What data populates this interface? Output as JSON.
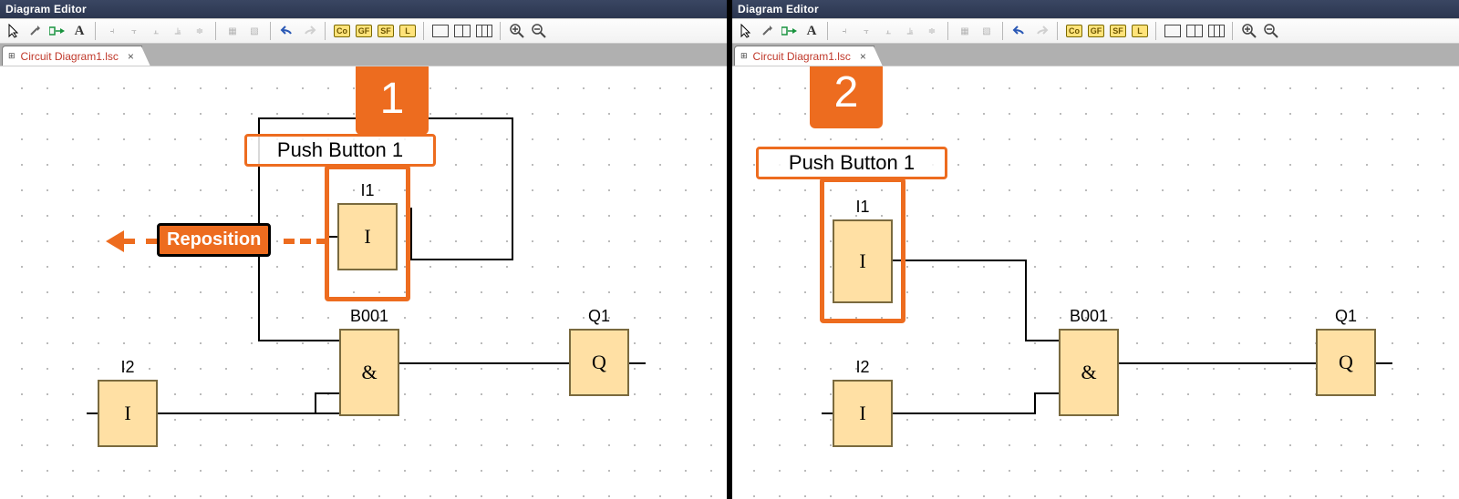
{
  "app": {
    "title": "Diagram Editor"
  },
  "tab": {
    "filename": "Circuit Diagram1.lsc",
    "close": "×"
  },
  "toolbar": {
    "badges": {
      "co": "Co",
      "gf": "GF",
      "sf": "SF",
      "l": "L"
    }
  },
  "annotations": {
    "left_badge": "1",
    "right_badge": "2",
    "pushbutton": "Push Button 1",
    "reposition": "Reposition"
  },
  "blocks": {
    "I1": {
      "label": "I1",
      "glyph": "I"
    },
    "I2": {
      "label": "I2",
      "glyph": "I"
    },
    "B001": {
      "label": "B001",
      "glyph": "&"
    },
    "Q1": {
      "label": "Q1",
      "glyph": "Q"
    }
  },
  "chart_data": [
    {
      "type": "diagram",
      "title": "Before reposition (step 1)",
      "annotation_badge": "1",
      "highlighted_block": "I1",
      "selected_label": "Push Button 1",
      "action_hint": "Reposition (arrow pointing left)",
      "blocks": [
        {
          "id": "I1",
          "type": "input",
          "text": "I",
          "approx_grid": {
            "x": 13,
            "y": 7
          }
        },
        {
          "id": "I2",
          "type": "input",
          "text": "I",
          "approx_grid": {
            "x": 4,
            "y": 15
          }
        },
        {
          "id": "B001",
          "type": "AND",
          "text": "&",
          "approx_grid": {
            "x": 13,
            "y": 12
          }
        },
        {
          "id": "Q1",
          "type": "output",
          "text": "Q",
          "approx_grid": {
            "x": 22,
            "y": 12
          }
        }
      ],
      "wires": [
        {
          "from": "I1.out",
          "to": "B001.in1"
        },
        {
          "from": "I2.out",
          "to": "B001.in2"
        },
        {
          "from": "B001.out",
          "to": "Q1.in"
        }
      ]
    },
    {
      "type": "diagram",
      "title": "After reposition (step 2)",
      "annotation_badge": "2",
      "highlighted_block": "I1",
      "selected_label": "Push Button 1",
      "blocks": [
        {
          "id": "I1",
          "type": "input",
          "text": "I",
          "approx_grid": {
            "x": 4,
            "y": 7
          }
        },
        {
          "id": "I2",
          "type": "input",
          "text": "I",
          "approx_grid": {
            "x": 4,
            "y": 15
          }
        },
        {
          "id": "B001",
          "type": "AND",
          "text": "&",
          "approx_grid": {
            "x": 13,
            "y": 12
          }
        },
        {
          "id": "Q1",
          "type": "output",
          "text": "Q",
          "approx_grid": {
            "x": 22,
            "y": 12
          }
        }
      ],
      "wires": [
        {
          "from": "I1.out",
          "to": "B001.in1"
        },
        {
          "from": "I2.out",
          "to": "B001.in2"
        },
        {
          "from": "B001.out",
          "to": "Q1.in"
        }
      ]
    }
  ]
}
